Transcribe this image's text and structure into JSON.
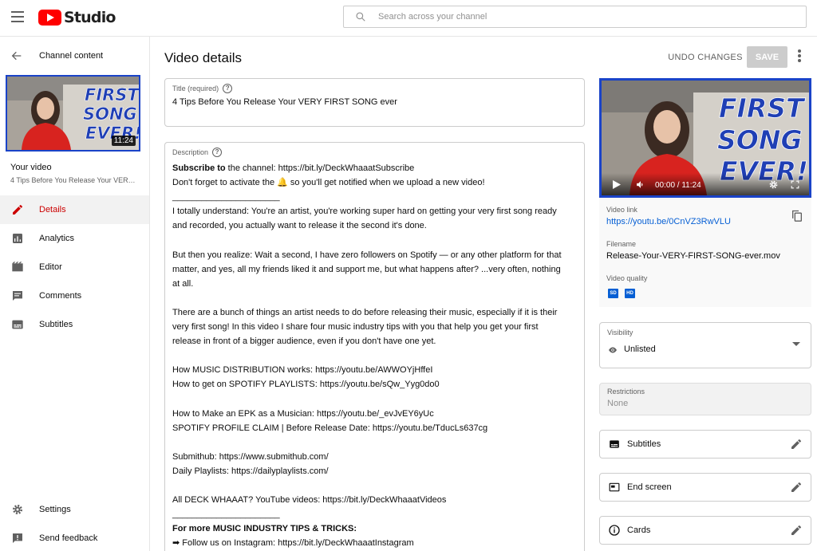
{
  "header": {
    "logo_text": "Studio",
    "search_placeholder": "Search across your channel"
  },
  "sidebar": {
    "back_label": "Channel content",
    "thumb_duration": "11:24",
    "your_video_title": "Your video",
    "your_video_subtitle": "4 Tips Before You Release Your VERY FIRST SONG ever",
    "items": [
      {
        "label": "Details",
        "icon": "pencil-icon",
        "active": true
      },
      {
        "label": "Analytics",
        "icon": "analytics-icon"
      },
      {
        "label": "Editor",
        "icon": "editor-icon"
      },
      {
        "label": "Comments",
        "icon": "comments-icon"
      },
      {
        "label": "Subtitles",
        "icon": "subtitles-icon"
      }
    ],
    "bottom_items": [
      {
        "label": "Settings",
        "icon": "gear-icon"
      },
      {
        "label": "Send feedback",
        "icon": "feedback-icon"
      }
    ]
  },
  "main": {
    "title": "Video details",
    "undo_label": "UNDO CHANGES",
    "save_label": "SAVE",
    "title_field": {
      "label": "Title (required)",
      "value": "4 Tips Before You Release Your VERY FIRST SONG ever"
    },
    "description": {
      "label": "Description",
      "lines": [
        {
          "bold": "Subscribe to",
          "text": " the channel: https://bit.ly/DeckWhaaatSubscribe"
        },
        {
          "text": "Don't forget to activate the 🔔 so you'll get notified when we upload a new video!"
        },
        {
          "text": "______________________"
        },
        {
          "text": "I totally understand: You're an artist, you're working super hard on getting your very first song ready"
        },
        {
          "text": "and recorded, you actually want to release it the second it's done."
        },
        {
          "text": ""
        },
        {
          "text": "But then you realize: Wait a second, I have zero followers on Spotify — or any other platform for that"
        },
        {
          "text": "matter, and yes, all my friends liked it and support me, but what happens after? ...very often, nothing"
        },
        {
          "text": "at all."
        },
        {
          "text": ""
        },
        {
          "text": "There are a bunch of things an artist needs to do before releasing their music, especially if it is their"
        },
        {
          "text": "very first song! In this video I share four music industry tips with you that help you get your first"
        },
        {
          "text": "release in front of a bigger audience, even if you don't have one yet."
        },
        {
          "text": ""
        },
        {
          "text": "How MUSIC DISTRIBUTION works: https://youtu.be/AWWOYjHffeI"
        },
        {
          "text": "How to get on SPOTIFY PLAYLISTS: https://youtu.be/sQw_Yyg0do0"
        },
        {
          "text": ""
        },
        {
          "text": "How to Make an EPK as a Musician: https://youtu.be/_evJvEY6yUc"
        },
        {
          "text": "SPOTIFY PROFILE CLAIM | Before Release Date: https://youtu.be/TducLs637cg"
        },
        {
          "text": ""
        },
        {
          "text": "Submithub: https://www.submithub.com/"
        },
        {
          "text": "Daily Playlists: https://dailyplaylists.com/"
        },
        {
          "text": ""
        },
        {
          "text": "All DECK WHAAAT? YouTube videos: https://bit.ly/DeckWhaaatVideos"
        },
        {
          "text": "______________________"
        },
        {
          "bold": "For more MUSIC INDUSTRY TIPS & TRICKS:",
          "text": ""
        },
        {
          "text": "➡ Follow us on Instagram: https://bit.ly/DeckWhaaatInstagram"
        }
      ]
    }
  },
  "preview": {
    "overlay_title": "FIRST SONG EVER!",
    "time": "00:00 / 11:24",
    "video_link_label": "Video link",
    "video_link": "https://youtu.be/0CnVZ3RwVLU",
    "filename_label": "Filename",
    "filename": "Release-Your-VERY-FIRST-SONG-ever.mov",
    "quality_label": "Video quality",
    "quality_badges": [
      "SD",
      "HD"
    ],
    "accent_color": "#065fd4"
  },
  "visibility": {
    "label": "Visibility",
    "value": "Unlisted"
  },
  "restrictions": {
    "label": "Restrictions",
    "value": "None"
  },
  "cards": [
    {
      "label": "Subtitles",
      "icon": "subtitles-icon"
    },
    {
      "label": "End screen",
      "icon": "end-screen-icon"
    },
    {
      "label": "Cards",
      "icon": "info-icon"
    }
  ]
}
